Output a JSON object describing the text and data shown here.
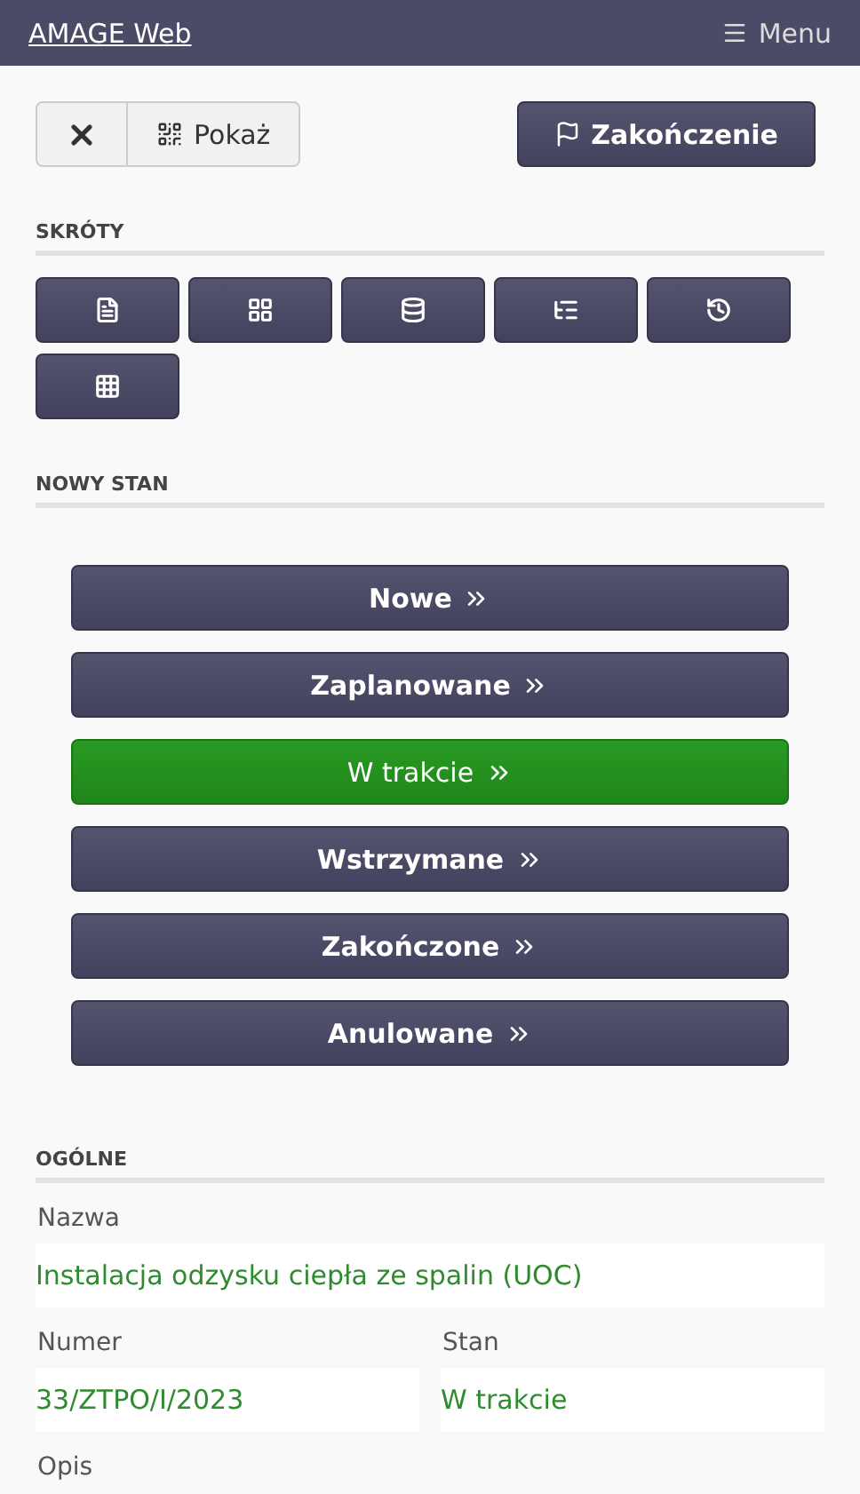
{
  "header": {
    "title": "AMAGE Web",
    "menu": "Menu"
  },
  "toolbar": {
    "show": "Pokaż",
    "finish": "Zakończenie"
  },
  "shortcuts": {
    "title": "SKRÓTY",
    "items": [
      {
        "kind": "document"
      },
      {
        "kind": "blocks"
      },
      {
        "kind": "database"
      },
      {
        "kind": "tree"
      },
      {
        "kind": "history"
      },
      {
        "kind": "grid"
      }
    ]
  },
  "new_state": {
    "title": "NOWY STAN",
    "items": [
      {
        "label": "Nowe",
        "selected": false
      },
      {
        "label": "Zaplanowane",
        "selected": false
      },
      {
        "label": "W trakcie",
        "selected": true
      },
      {
        "label": "Wstrzymane",
        "selected": false
      },
      {
        "label": "Zakończone",
        "selected": false
      },
      {
        "label": "Anulowane",
        "selected": false
      }
    ]
  },
  "general": {
    "title": "OGÓLNE",
    "name": {
      "label": "Nazwa",
      "value": "Instalacja odzysku ciepła ze spalin (UOC)"
    },
    "number": {
      "label": "Numer",
      "value": "33/ZTPO/I/2023"
    },
    "state": {
      "label": "Stan",
      "value": "W trakcie"
    },
    "description": {
      "label": "Opis"
    }
  }
}
